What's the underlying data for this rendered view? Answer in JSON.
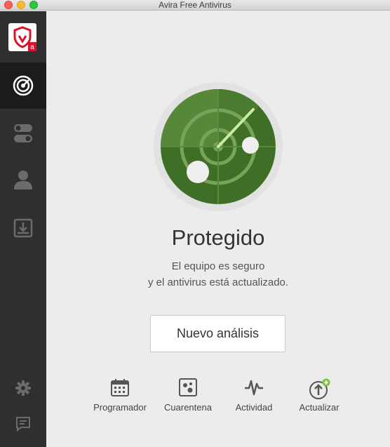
{
  "window": {
    "title": "Avira Free Antivirus"
  },
  "sidebar": {
    "logo_icon": "avira-umbrella-logo",
    "items": [
      {
        "icon": "radar-icon",
        "active": true
      },
      {
        "icon": "toggles-icon",
        "active": false
      },
      {
        "icon": "user-icon",
        "active": false
      },
      {
        "icon": "download-icon",
        "active": false
      }
    ],
    "bottom": [
      {
        "icon": "gear-icon"
      },
      {
        "icon": "feedback-icon"
      }
    ]
  },
  "status": {
    "title": "Protegido",
    "line1": "El equipo es seguro",
    "line2": "y el antivirus está actualizado."
  },
  "scan_button": {
    "label": "Nuevo análisis"
  },
  "actions": [
    {
      "icon": "calendar-icon",
      "label": "Programador"
    },
    {
      "icon": "quarantine-icon",
      "label": "Cuarentena"
    },
    {
      "icon": "activity-icon",
      "label": "Actividad"
    },
    {
      "icon": "update-icon",
      "label": "Actualizar"
    }
  ],
  "colors": {
    "sidebar": "#2f2f2f",
    "sidebar_active": "#1c1c1c",
    "radar_green": "#3f6e26",
    "brand_red": "#d5142b",
    "update_badge": "#7cc243"
  }
}
